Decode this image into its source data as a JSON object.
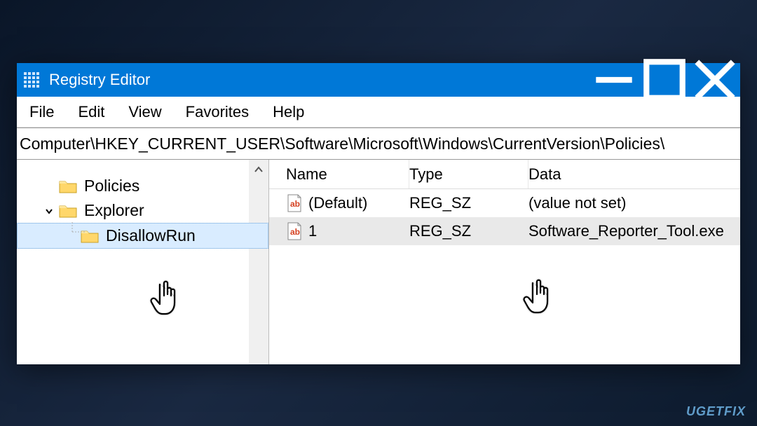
{
  "window": {
    "title": "Registry Editor"
  },
  "menubar": [
    "File",
    "Edit",
    "View",
    "Favorites",
    "Help"
  ],
  "address": "Computer\\HKEY_CURRENT_USER\\Software\\Microsoft\\Windows\\CurrentVersion\\Policies\\",
  "tree": {
    "items": [
      {
        "label": "Policies"
      },
      {
        "label": "Explorer"
      },
      {
        "label": "DisallowRun"
      }
    ]
  },
  "list": {
    "headers": {
      "name": "Name",
      "type": "Type",
      "data": "Data"
    },
    "rows": [
      {
        "name": "(Default)",
        "type": "REG_SZ",
        "data": "(value not set)"
      },
      {
        "name": "1",
        "type": "REG_SZ",
        "data": "Software_Reporter_Tool.exe"
      }
    ]
  },
  "watermark": "UGETFIX"
}
